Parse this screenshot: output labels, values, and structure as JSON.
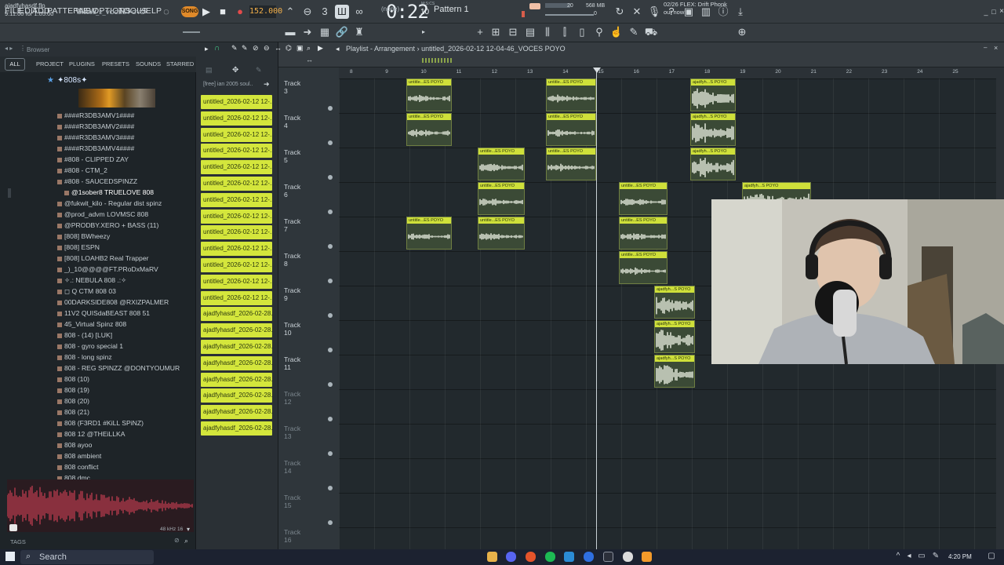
{
  "menubar": {
    "items": [
      "FILE",
      "EDIT",
      "ADD",
      "PATTERNS",
      "VIEW",
      "OPTIONS",
      "TOOLS",
      "HELP"
    ],
    "song_label": "SONG",
    "tempo": "152.000",
    "time_big": "0:22",
    "time_small": "10",
    "time_unit": "M:S:CS",
    "cpu_num": "20",
    "mem": "568 MB",
    "voices": "0"
  },
  "toolbar2": {
    "project_file": "ajadfyhasdf.flp",
    "project_time": "9:11:00 for 1:05:00",
    "song_name": "untitled_2_VOCES POYO",
    "snap": "(none)",
    "pattern": "Pattern 1",
    "hint_line1": "02/26  FLEX: Drift Phonk",
    "hint_line2": "out now!"
  },
  "browser": {
    "label": "Browser",
    "tabs": [
      "ALL",
      "PROJECT",
      "PLUGINS",
      "PRESETS",
      "SOUNDS",
      "STARRED"
    ],
    "folder_title": "✦808s✦",
    "items": [
      "####R3DB3AMV1####",
      "####R3DB3AMV2####",
      "####R3DB3AMV3####",
      "####R3DB3AMV4####",
      "#808 - CLIPPED ZAY",
      "#808 - CTM_2",
      "#808 - SAUCEDSPINZZ",
      "@1sober8 TRUELOVE 808",
      "@fukwit_kilo - Regular dist spinz",
      "@prod_advm LOVMSC 808",
      "@PRODBY.XERO + BASS (11)",
      "[808] BWheezy",
      "[808] ESPN",
      "[808] LOAHB2 Real Trapper",
      "_)_10@@@@FT.PRoDxMaRV",
      "✧.: NEBULA 808 .:✧",
      "◻ Q CTM 808 03",
      "00DARKSIDE808 @RXIZPALMER",
      "11V2 QUISdaBEAST 808 51",
      "45_Virtual Spinz 808",
      "808 - (14) [LUK]",
      "808 - gyro special 1",
      "808 - long spinz",
      "808 - REG SPINZZ @DONTYOUMUR",
      "808 (10)",
      "808 (19)",
      "808 (20)",
      "808 (21)",
      "808 (F3RD1 #KiLL SPiNZ)",
      "808 12 @THEiLLKA",
      "808 ayoo",
      "808 ambient",
      "808 conflict",
      "808 dmc"
    ],
    "wave_info": "48 kHz 16",
    "tags_label": "TAGS"
  },
  "picker": {
    "top_label": "[free] ian 2005 soul..",
    "clips": [
      "untitled_2026-02-12 12-...",
      "untitled_2026-02-12 12-...",
      "untitled_2026-02-12 12-...",
      "untitled_2026-02-12 12-...",
      "untitled_2026-02-12 12-...",
      "untitled_2026-02-12 12-...",
      "untitled_2026-02-12 12-...",
      "untitled_2026-02-12 12-...",
      "untitled_2026-02-12 12-...",
      "untitled_2026-02-12 12-...",
      "untitled_2026-02-12 12-...",
      "untitled_2026-02-12 12-...",
      "untitled_2026-02-12 12-...",
      "ajadfyhasdf_2026-02-28...",
      "ajadfyhasdf_2026-02-28...",
      "ajadfyhasdf_2026-02-28...",
      "ajadfyhasdf_2026-02-28...",
      "ajadfyhasdf_2026-02-28...",
      "ajadfyhasdf_2026-02-28...",
      "ajadfyhasdf_2026-02-28...",
      "ajadfyhasdf_2026-02-28..."
    ]
  },
  "playlist": {
    "title": "Playlist - Arrangement",
    "pattern_name": "untitled_2026-02-12 12-04-46_VOCES POYO",
    "bars": [
      "8",
      "9",
      "10",
      "11",
      "12",
      "13",
      "14",
      "15",
      "16",
      "17",
      "18",
      "19",
      "20",
      "21",
      "22",
      "23",
      "24",
      "25"
    ],
    "tracks": [
      "Track 3",
      "Track 4",
      "Track 5",
      "Track 6",
      "Track 7",
      "Track 8",
      "Track 9",
      "Track 10",
      "Track 11",
      "Track 12",
      "Track 13",
      "Track 14",
      "Track 15",
      "Track 16"
    ],
    "clip_labels": {
      "untitle": "untitle...ES POYO",
      "ajad": "ajadfyh...S POYO"
    }
  },
  "taskbar": {
    "search_placeholder": "Search",
    "clock": "4:20 PM"
  },
  "colors": {
    "clip_label": "#cfe03a",
    "picker_clip": "#d4e63c",
    "accent_orange": "#e08a2a",
    "tempo_text": "#f4b04a"
  }
}
